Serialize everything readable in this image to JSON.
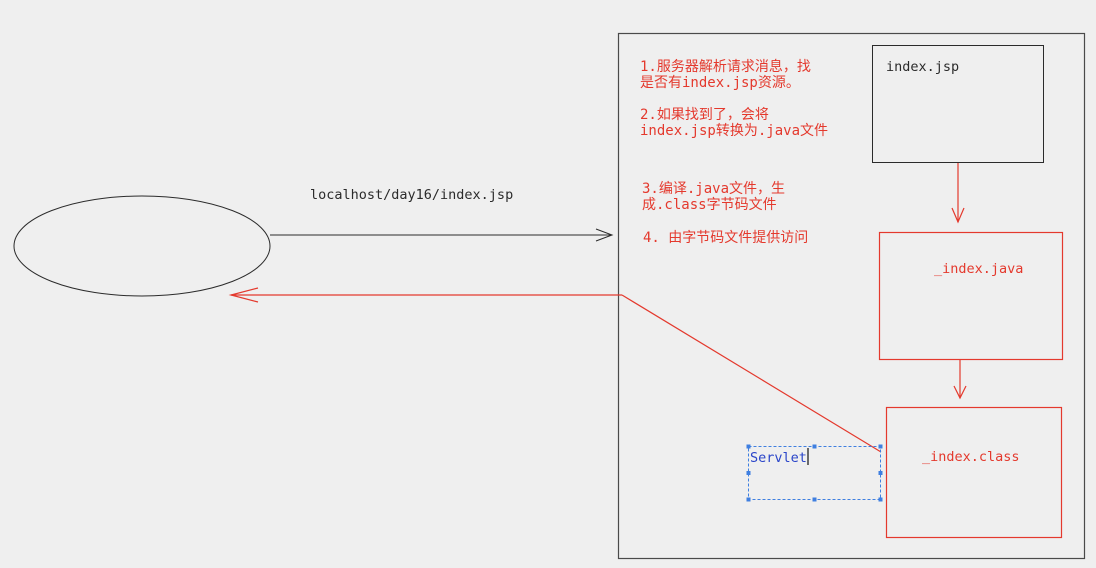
{
  "colors": {
    "background": "#efefef",
    "ink": "#2b2b2b",
    "frame": "#4a4a4a",
    "accent_red": "#e4392d",
    "selection_blue": "#3f7fe0",
    "servlet_text_blue": "#2a45c9"
  },
  "client": {
    "request_url": "localhost/day16/index.jsp"
  },
  "server": {
    "steps": [
      {
        "lines": [
          "1.服务器解析请求消息，找",
          "是否有index.jsp资源。"
        ]
      },
      {
        "lines": [
          "2.如果找到了，会将",
          "index.jsp转换为.java文件"
        ]
      },
      {
        "lines": [
          "3.编译.java文件，生",
          "成.class字节码文件"
        ]
      },
      {
        "lines": [
          "4. 由字节码文件提供访问"
        ]
      }
    ],
    "files": {
      "jsp": "index.jsp",
      "java": "_index.java",
      "class": "_index.class"
    },
    "servlet_label": "Servlet"
  }
}
